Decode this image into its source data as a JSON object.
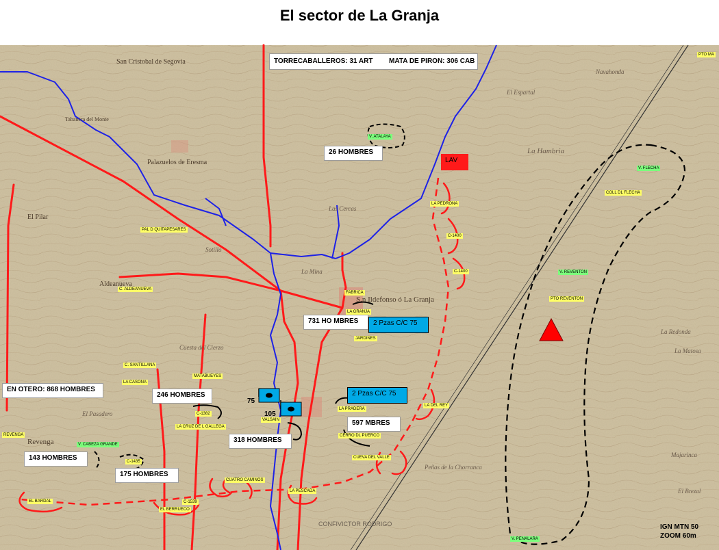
{
  "title": "El sector de La Granja",
  "summary_box": {
    "torrecaballeros": "TORRECABALLEROS: 31 ART",
    "mata_de_piron": "MATA DE PIRON: 306 CAB"
  },
  "troop_labels": {
    "atalaya": "26 HOMBRES",
    "granja": "731 HO MBRES",
    "otero": "EN OTERO: 868 HOMBRES",
    "west_246": "246 HOMBRES",
    "valsain_318": "318 HOMBRES",
    "pradera_597": "597 MBRES",
    "revenga_143": "143 HOMBRES",
    "west_175": "175 HOMBRES"
  },
  "units": {
    "gun_north": "2 Pzas C/C 75",
    "gun_south": "2 Pzas C/C 75",
    "lav": "LAV"
  },
  "unit_numbers": {
    "n75": "75",
    "n105": "105"
  },
  "place_labels": {
    "pto_mas": "PTO MA",
    "v_atalaya": "V. ATALAYA",
    "la_pedrona": "LA PEDRONA",
    "c1400a": "C-1400",
    "c1400b": "C-1400",
    "v_flecha": "V. FLECHA",
    "coll_flecha": "COLL DL FLECHA",
    "pal_quitapesares": "PAL D QUITAPESARES",
    "v_reventon": "V. REVENTON",
    "pto_reventon": "PTO REVENTON",
    "fabrica": "FABRICA",
    "la_granja": "LA GRANJA",
    "jardines": "JARDINES",
    "c_aldeanueva": "C. ALDEANUEVA",
    "c_santillana": "C. SANTILLANA",
    "la_casona": "LA CASONA",
    "matabueyes": "MATABUEYES",
    "c1382": "C-1382",
    "la_cruz_gallega": "LA CRUZ DE L GALLEGA",
    "valsain": "VALSAIN",
    "la_pradera": "LA PRADERA",
    "cerro_puerco": "CERRO DL PUERCO",
    "cueva_del_valle": "CUEVA DEL VALLE",
    "la_silla_del_rey": "LA DEL REY",
    "revenga": "REVENGA",
    "v_cabeza_grande": "V. CABEZA GRANDE",
    "c1435": "C-1435",
    "cuatro_caminos": "CUATRO CAMINOS",
    "la_pescada": "LA PESCADA",
    "el_bardal": "EL BARDAL",
    "el_berrueco": "EL BERRUECO",
    "c1539": "C-1539",
    "v_penalara": "V. PENALARA",
    "confivictor": "CONFIVICTOR RODRIGO"
  },
  "map_text": {
    "san_cristobal": "San Cristobal de Segovia",
    "palazuelos": "Palazuelos de Eresma",
    "tabanera": "Tabanera del Monte",
    "san_ildefonso": "S.n Ildefonso ó La Granja",
    "la_hambria": "La Hambria",
    "el_espartal": "El Espartal",
    "aldeanueva": "Aldeanueva",
    "revenga_town": "Revenga",
    "el_pasadero": "El Pasadero",
    "navahonda": "Navahonda",
    "la_redonda": "La Redonda",
    "la_matosa": "La Matosa",
    "el_brezal": "El Brezal",
    "majarinca": "Majarinca",
    "peñas_chorranca": "Peñas de la Chorranca",
    "las_cercas": "Las Cercas",
    "la_mina": "La Mina",
    "el_quintanar": "Cuesta del Cierzo",
    "el_sotillo": "Sotillo",
    "el_pilar": "El Pilar"
  },
  "scale_note": {
    "line1": "IGN MTN 50",
    "line2": "ZOOM 60m"
  },
  "colors": {
    "map_bg": "#c7bb9b",
    "river": "#1e22e6",
    "road": "#ff1a1a",
    "defense_line": "#ff1a1a",
    "sector": "#000000",
    "unit": "#00a9e6",
    "triangle": "#ff0000"
  }
}
